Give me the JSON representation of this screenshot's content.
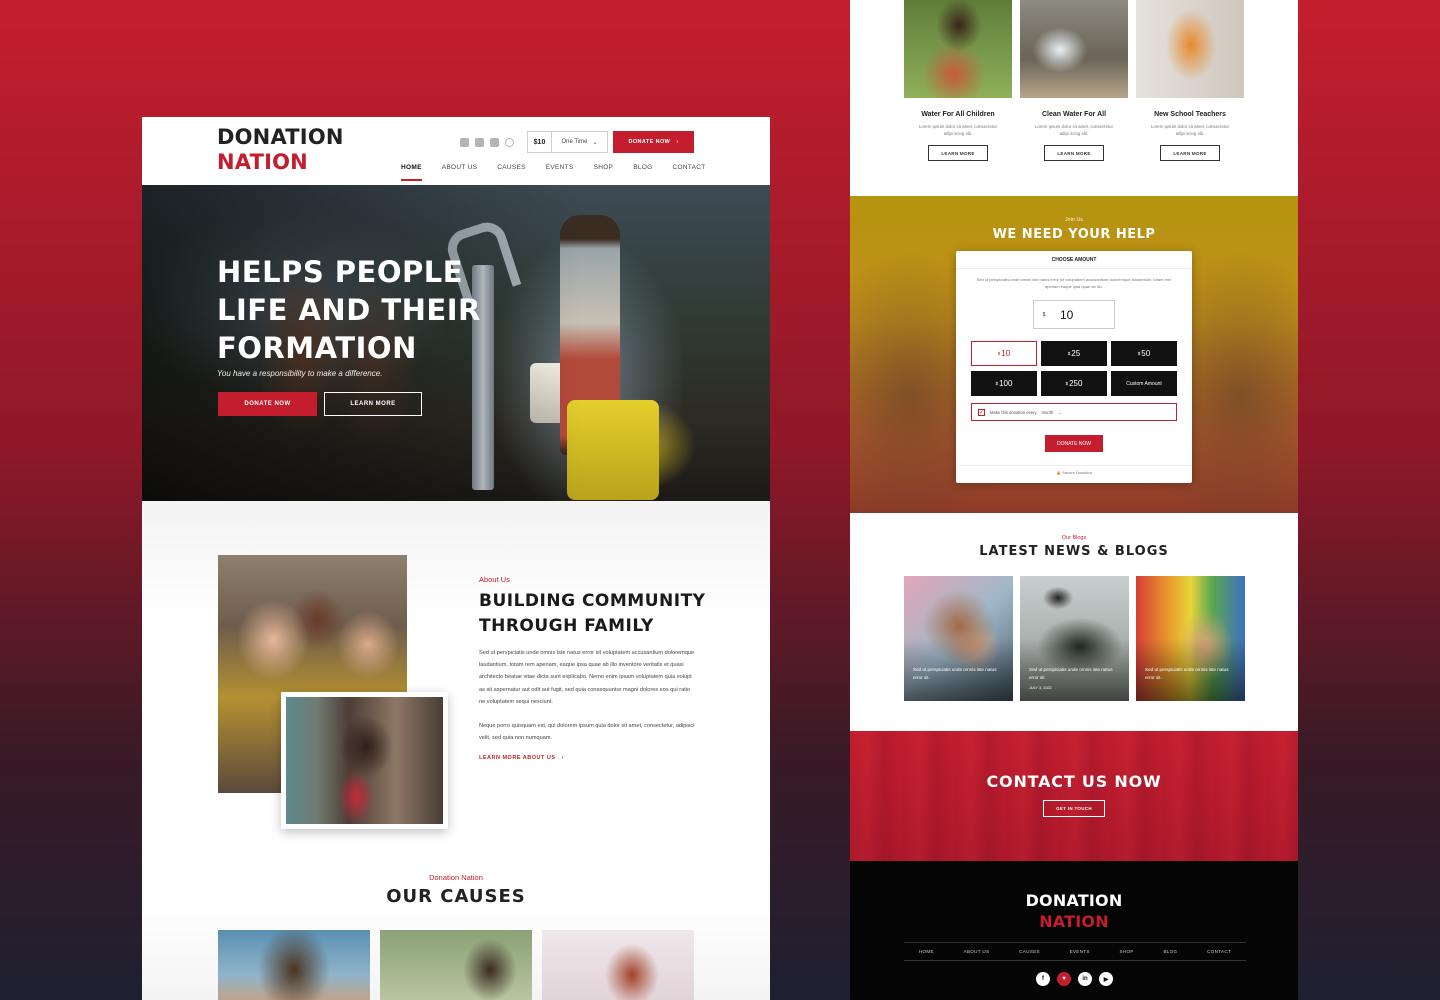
{
  "left": {
    "logo": {
      "line1": "DONATION",
      "line2": "NATION"
    },
    "header": {
      "amount": "$10",
      "frequency": "One Time",
      "donate": "DONATE NOW",
      "nav": [
        "HOME",
        "ABOUT US",
        "CAUSES",
        "EVENTS",
        "SHOP",
        "BLOG",
        "CONTACT"
      ],
      "active_nav": "HOME",
      "social_icons": [
        "facebook-icon",
        "twitter-icon",
        "youtube-icon",
        "instagram-icon"
      ]
    },
    "hero": {
      "title_l1": "HELPS PEOPLE",
      "title_l2": "LIFE AND THEIR",
      "title_l3": "FORMATION",
      "subtitle": "You have a responsibility to make a difference.",
      "donate": "DONATE NOW",
      "learn": "LEARN MORE"
    },
    "about": {
      "eyebrow": "About Us",
      "title_l1": "BUILDING COMMUNITY",
      "title_l2": "THROUGH FAMILY",
      "p1": "Sed ut perspiciatis unde omnis iste natus error sit voluptatem accusantium doloremque laudantium, totam rem aperiam, eaque ipsa quae ab illo inventore veritatis et quasi architecto beatae vitae dicta sunt explicabo. Nemo enim ipsam voluptatem quia volupt as sit aspernatur aut odit aut fugit, sed quia consequuntur magni dolores eos qui ratio ne voluptatem sequi nesciunt.",
      "p2": "Neque porro quisquam est, qui dolorem ipsum quia dolor sit amet, consectetur, adipisci velit, sed quia non numquam.",
      "learn": "LEARN MORE ABOUT US"
    },
    "causes": {
      "eyebrow": "Donation Nation",
      "title": "OUR CAUSES"
    }
  },
  "right": {
    "causes": [
      {
        "title": "Water For All Children",
        "text": "Lorem ipsum dolor sit amet, consectetur adipi scing elit.",
        "button": "LEARN MORE"
      },
      {
        "title": "Clean Water For All",
        "text": "Lorem ipsum dolor sit amet, consectetur adipi scing elit.",
        "button": "LEARN MORE"
      },
      {
        "title": "New School Teachers",
        "text": "Lorem ipsum dolor sit amet, consectetur adipi scing elit.",
        "button": "LEARN MORE"
      }
    ],
    "help": {
      "eyebrow": "Join Us",
      "title": "WE NEED YOUR HELP",
      "choose": "CHOOSE AMOUNT",
      "desc": "Sed ut perspiciatis unde omnis iste natus error sit voluptatem accusantium doloremque laudantium, totam rem aperiam eaque ipsa quae ab illo.",
      "currency": "$",
      "amount": "10",
      "options": [
        {
          "cur": "$",
          "val": "10"
        },
        {
          "cur": "$",
          "val": "25"
        },
        {
          "cur": "$",
          "val": "50"
        },
        {
          "cur": "$",
          "val": "100"
        },
        {
          "cur": "$",
          "val": "250"
        },
        {
          "cur": "",
          "val": "Custom Amount"
        }
      ],
      "selected_option": "10",
      "recurring": "Make this donation every",
      "recurring_period": "month",
      "donate": "DONATE NOW",
      "secure": "Secure Donation"
    },
    "news": {
      "eyebrow": "Our Blogs",
      "title": "LATEST NEWS & BLOGS",
      "posts": [
        {
          "caption": "Sed ut perspiciatis unde omnis iste natus error sit.",
          "date": ""
        },
        {
          "caption": "Sed ut perspiciatis unde omnis iste natus error sit",
          "date": "JULY 3, 2022"
        },
        {
          "caption": "Sed ut perspiciatis unde omnis iste natus error sit.",
          "date": ""
        }
      ]
    },
    "contact": {
      "title": "CONTACT US NOW",
      "button": "GET IN TOUCH"
    },
    "footer": {
      "logo_l1": "DONATION",
      "logo_l2": "NATION",
      "nav": [
        "HOME",
        "ABOUT US",
        "CAUSES",
        "EVENTS",
        "SHOP",
        "BLOG",
        "CONTACT"
      ],
      "social": [
        "f",
        "♥",
        "in",
        "▶"
      ],
      "social_icons": [
        "facebook-icon",
        "heart-icon",
        "linkedin-icon",
        "youtube-icon"
      ]
    }
  },
  "colors": {
    "brand_red": "#c41e2e",
    "dark": "#111111",
    "gold": "#b59410"
  }
}
